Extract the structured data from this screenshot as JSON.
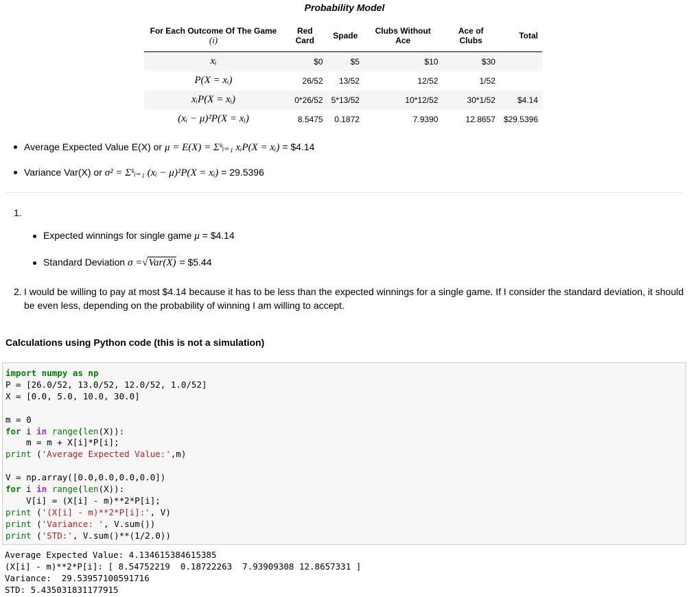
{
  "title": "Probability Model",
  "table": {
    "header_outcome": "For Each Outcome Of The Game",
    "header_outcome_sub": "(i)",
    "columns": [
      "Red Card",
      "Spade",
      "Clubs Without Ace",
      "Ace of Clubs",
      "Total"
    ],
    "rows": [
      {
        "label": "xᵢ",
        "cells": [
          "$0",
          "$5",
          "$10",
          "$30",
          ""
        ]
      },
      {
        "label": "P(X = xᵢ)",
        "cells": [
          "26/52",
          "13/52",
          "12/52",
          "1/52",
          ""
        ]
      },
      {
        "label": "xᵢP(X = xᵢ)",
        "cells": [
          "0*26/52",
          "5*13/52",
          "10*12/52",
          "30*1/52",
          "$4.14"
        ]
      },
      {
        "label": "(xᵢ − μ)²P(X = xᵢ)",
        "cells": [
          "8.5475",
          "0.1872",
          "7.9390",
          "12.8657",
          "$29.5396"
        ]
      }
    ]
  },
  "summary": {
    "expected_prefix": "Average Expected Value E(X) or",
    "expected_math": "μ = E(X) = Σᵏᵢ₌₁ xᵢP(X = xᵢ)",
    "expected_value": "= $4.14",
    "variance_prefix": "Variance Var(X) or",
    "variance_math": "σ² = Σᵏᵢ₌₁ (xᵢ − μ)²P(X = xᵢ)",
    "variance_value": "= 29.5396"
  },
  "answers": {
    "item1_number": "1.",
    "mu_text": "Expected winnings for single game",
    "mu_symbol": "μ",
    "mu_value": "= $4.14",
    "sd_text": "Standard Deviation",
    "sd_math_lhs": "σ =",
    "sd_math_rad": "Var(X)",
    "sd_value": "= $5.44",
    "item2_number": "2.",
    "item2_line1": "I would be willing to pay at most $4.14 because it has to be less than the expected winnings for a single game. If I consider the standard deviation, it should",
    "item2_line2": "be even less, depending on the probability of winning I am willing to accept."
  },
  "calc_heading": "Calculations using Python code (this is not a simulation)",
  "code": {
    "l1_import": "import",
    "l1_mod": " numpy ",
    "l1_as": "as",
    "l1_np": " np",
    "l2": "P = [26.0/52, 13.0/52, 12.0/52, 1.0/52]",
    "l3": "X = [0.0, 5.0, 10.0, 30.0]",
    "l5": "m = 0",
    "l6_for": "for",
    "l6_a": " i ",
    "l6_in": "in",
    "l6_b": " ",
    "l6_range": "range",
    "l6_c": "(",
    "l6_len": "len",
    "l6_d": "(X)):",
    "l7": "    m = m + X[i]*P[i];",
    "l8_print": "print",
    "l8_a": " (",
    "l8_str": "'Average Expected Value:'",
    "l8_b": ",m)",
    "l10": "V = np.array([0.0,0.0,0.0,0.0])",
    "l11_for": "for",
    "l11_a": " i ",
    "l11_in": "in",
    "l11_b": " ",
    "l11_range": "range",
    "l11_c": "(",
    "l11_len": "len",
    "l11_d": "(X)):",
    "l12": "    V[i] = (X[i] - m)**2*P[i];",
    "l13_print": "print",
    "l13_a": " (",
    "l13_str": "'(X[i] - m)**2*P[i]:'",
    "l13_b": ", V)",
    "l14_print": "print",
    "l14_a": " (",
    "l14_str": "'Variance: '",
    "l14_b": ", V.sum())",
    "l15_print": "print",
    "l15_a": " (",
    "l15_str": "'STD:'",
    "l15_b": ", V.sum()**(1/2.0))"
  },
  "output": {
    "line1": "Average Expected Value: 4.134615384615385",
    "line2": "(X[i] - m)**2*P[i]: [ 8.54752219  0.18722263  7.93909308 12.8657331 ]",
    "line3": "Variance:  29.53957100591716",
    "line4": "STD: 5.435031831177915"
  }
}
